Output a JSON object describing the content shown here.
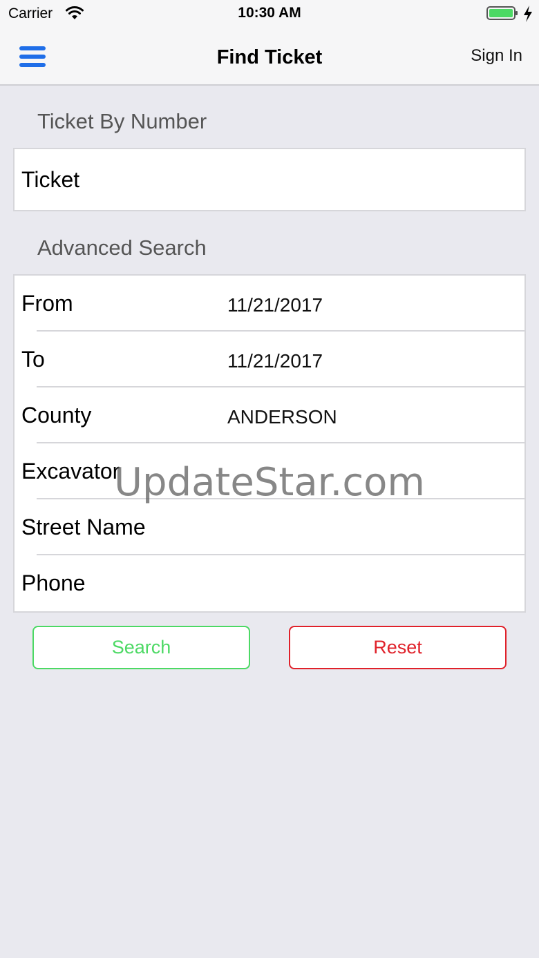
{
  "status_bar": {
    "carrier": "Carrier",
    "time": "10:30 AM",
    "battery_color": "#4cd964"
  },
  "nav": {
    "menu_icon": "hamburger-menu-icon",
    "title": "Find Ticket",
    "sign_in": "Sign In",
    "accent_color": "#1f6ee8"
  },
  "ticket_section": {
    "header": "Ticket By Number",
    "placeholder": "Ticket",
    "value": ""
  },
  "advanced_section": {
    "header": "Advanced Search",
    "rows": [
      {
        "label": "From",
        "value": "11/21/2017"
      },
      {
        "label": "To",
        "value": "11/21/2017"
      },
      {
        "label": "County",
        "value": "ANDERSON"
      },
      {
        "label": "Excavator",
        "value": ""
      },
      {
        "label": "Street Name",
        "value": ""
      },
      {
        "label": "Phone",
        "value": ""
      }
    ]
  },
  "buttons": {
    "search": "Search",
    "reset": "Reset",
    "search_color": "#4cd964",
    "reset_color": "#e0212a"
  },
  "watermark": "UpdateStar.com"
}
